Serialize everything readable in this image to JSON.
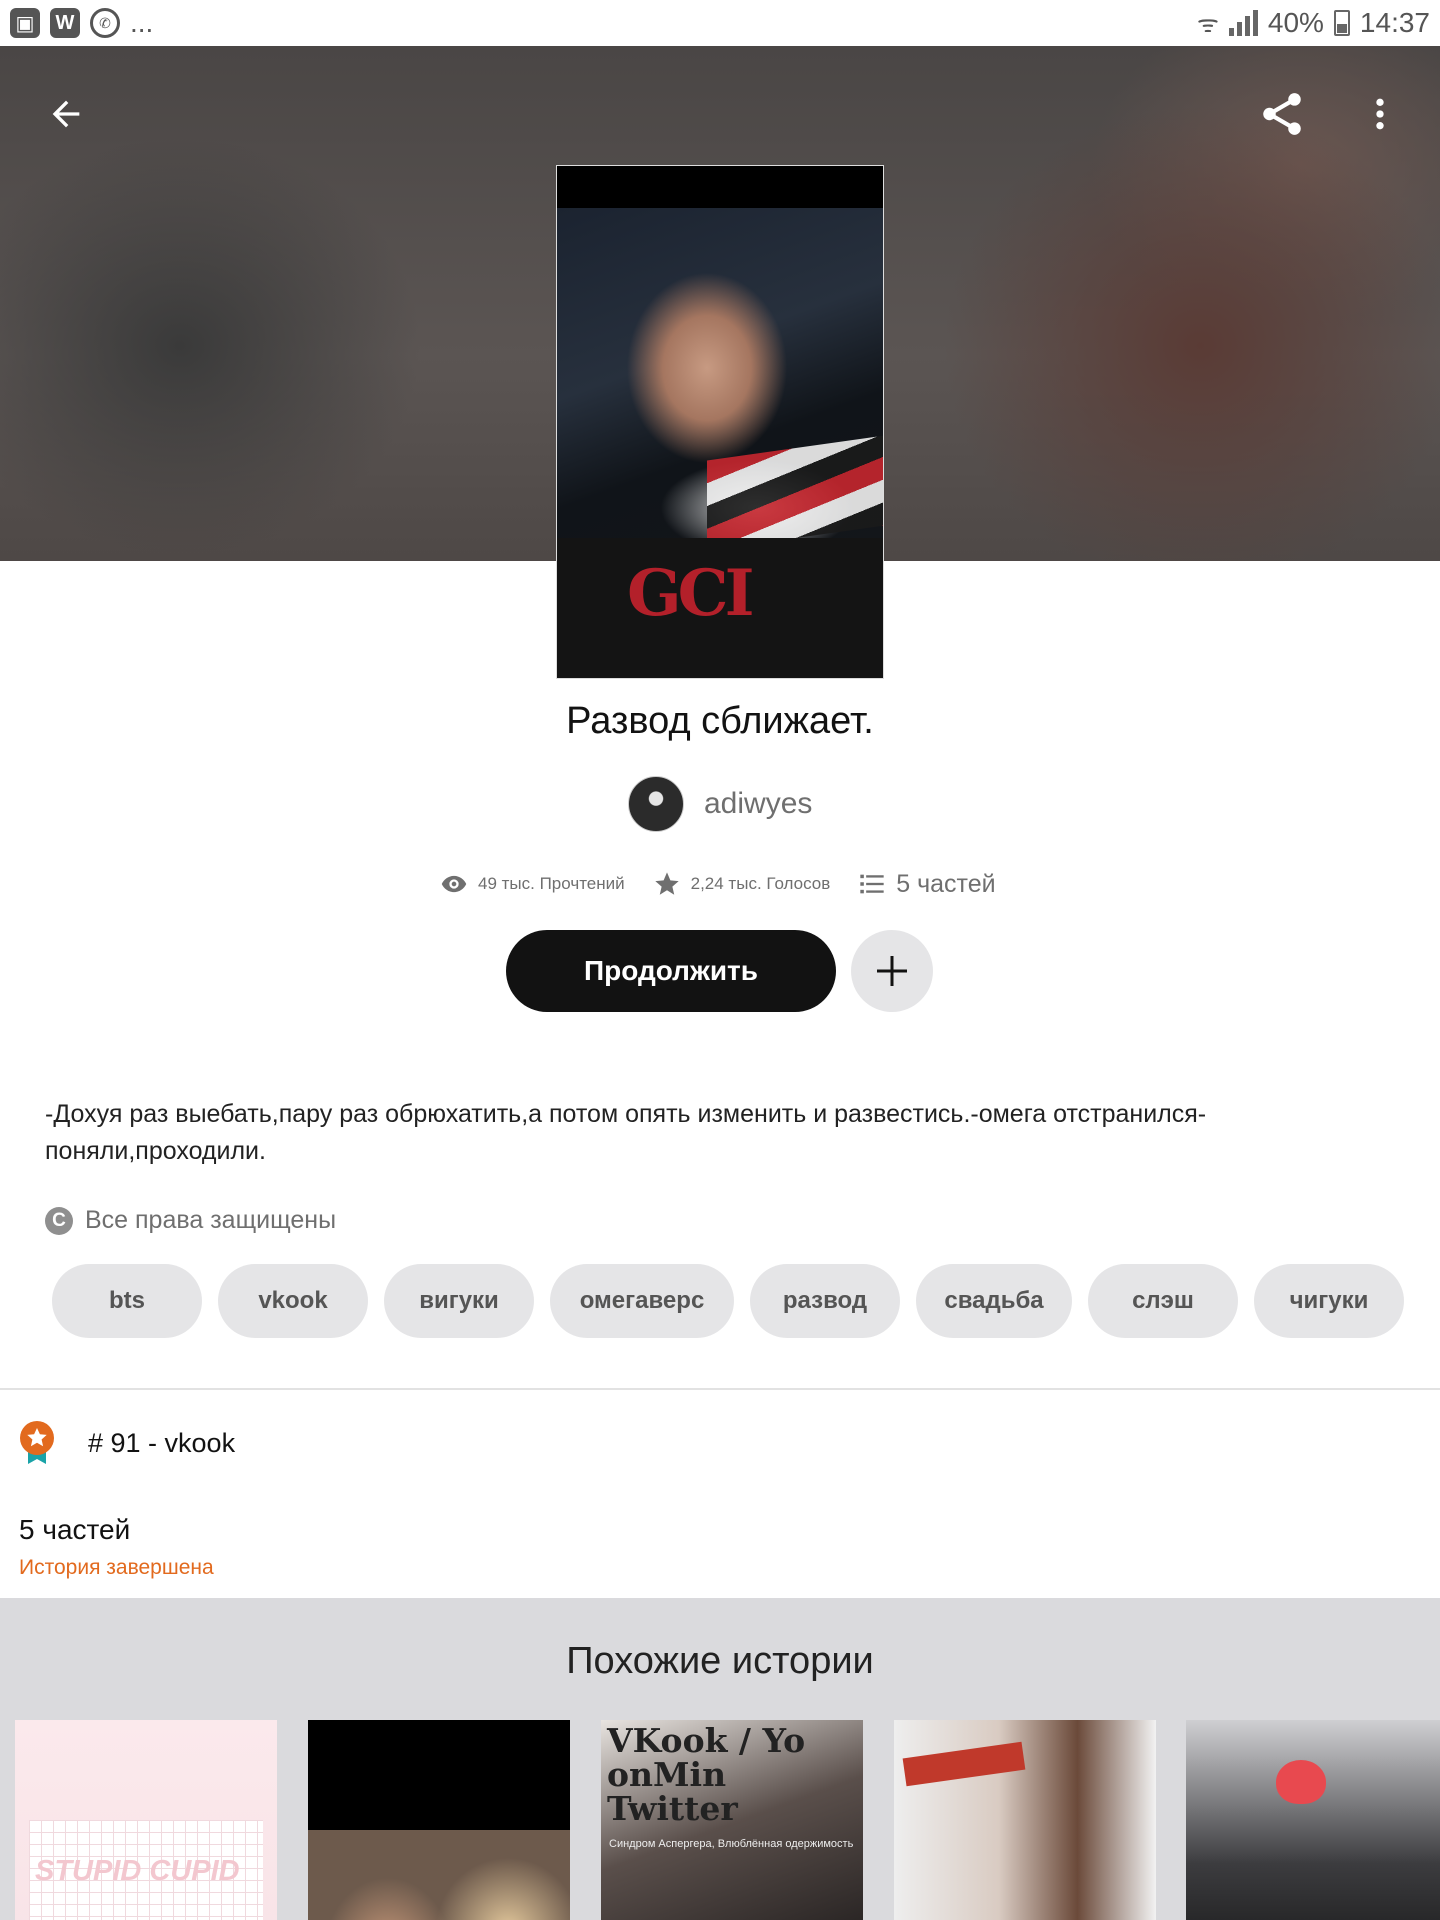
{
  "status_bar": {
    "left_icons": [
      "gallery-icon",
      "wattpad-icon",
      "viber-icon"
    ],
    "ellipsis": "...",
    "battery": "40%",
    "time": "14:37"
  },
  "header": {
    "back_icon": "arrow-left-icon",
    "share_icon": "share-icon",
    "more_icon": "more-vertical-icon"
  },
  "story": {
    "title": "Развод сближает.",
    "author": "adiwyes",
    "stats": {
      "reads": "49 тыс. Прочтений",
      "votes": "2,24 тыс. Голосов",
      "parts": "5 частей"
    },
    "continue_label": "Продолжить",
    "description": "-Дохуя раз выебать,пару раз обрюхатить,а потом опять изменить и развестись.-омега отстранился-поняли,проходили.",
    "copyright": "Все права защищены",
    "tags": [
      "bts",
      "vkook",
      "вигуки",
      "омегаверс",
      "развод",
      "свадьба",
      "слэш",
      "чигуки"
    ],
    "rank": "# 91 - vkook",
    "parts_count": "5 частей",
    "status": "История завершена"
  },
  "similar": {
    "title": "Похожие истории",
    "cards": [
      {
        "text": "STUPID CUPID",
        "subtitle": ""
      },
      {
        "text": "",
        "subtitle": ""
      },
      {
        "text": "VKook / Yo onMin Twitter",
        "subtitle": "Синдром Аспергера, Влюблённая одержимость"
      },
      {
        "text": "",
        "subtitle": ""
      },
      {
        "text": "",
        "subtitle": ""
      }
    ]
  },
  "colors": {
    "accent_orange": "#e26a1e",
    "button_dark": "#121212",
    "chip_bg": "#e5e5e7",
    "similar_bg": "#dadadd"
  }
}
